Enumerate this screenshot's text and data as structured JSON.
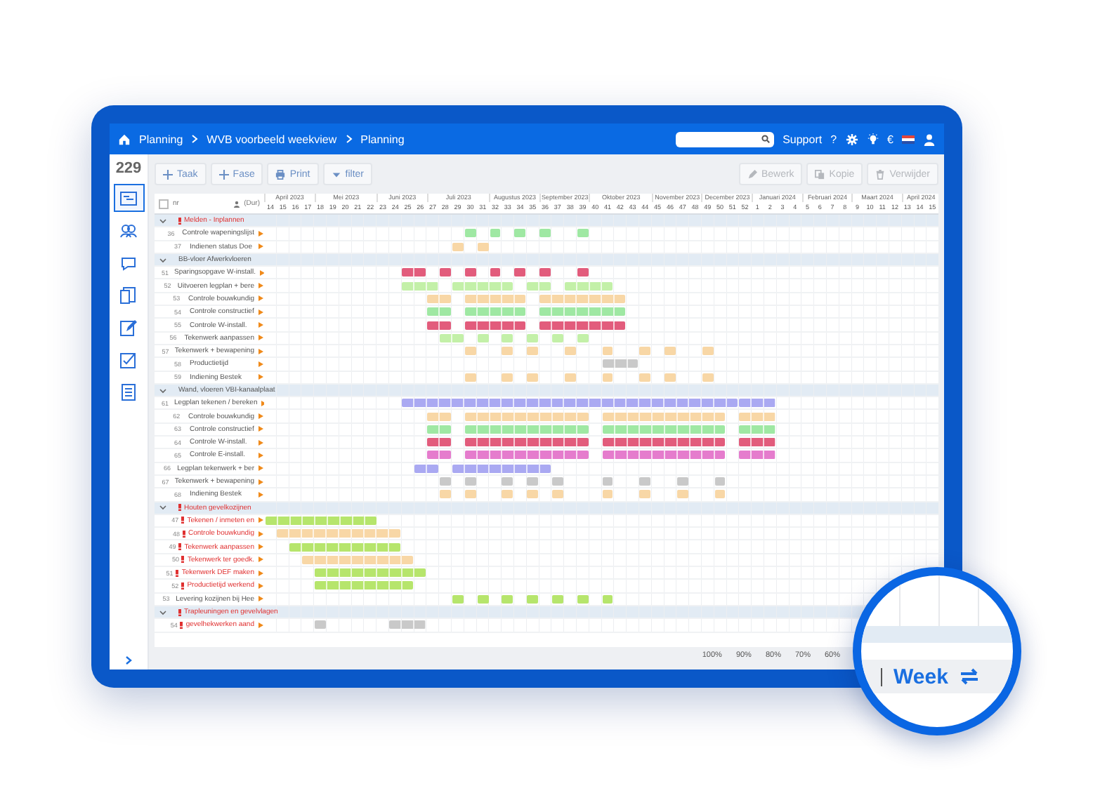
{
  "nav": {
    "breadcrumb": [
      "Planning",
      "WVB voorbeeld weekview",
      "Planning"
    ],
    "support": "Support",
    "help": "?",
    "currency": "€"
  },
  "sidebar": {
    "count": "229",
    "items": [
      {
        "selected": true
      },
      {
        "selected": false
      },
      {
        "selected": false
      },
      {
        "selected": false
      },
      {
        "selected": false
      },
      {
        "selected": false
      },
      {
        "selected": false
      }
    ]
  },
  "toolbar": {
    "left": [
      {
        "label": "Taak",
        "kind": "add",
        "disabled": false
      },
      {
        "label": "Fase",
        "kind": "add",
        "disabled": false
      },
      {
        "label": "Print",
        "kind": "print",
        "disabled": false
      },
      {
        "label": "filter",
        "kind": "filter",
        "disabled": false
      }
    ],
    "right": [
      {
        "label": "Bewerk",
        "kind": "edit",
        "disabled": true
      },
      {
        "label": "Kopie",
        "kind": "copy",
        "disabled": true
      },
      {
        "label": "Verwijder",
        "kind": "delete",
        "disabled": true
      }
    ]
  },
  "gantt": {
    "header": {
      "nr": "nr",
      "duration": "(Dur)",
      "checked": false
    },
    "months": [
      {
        "label": "April 2023",
        "weeks": [
          "14",
          "15",
          "16",
          "17"
        ]
      },
      {
        "label": "Mei 2023",
        "weeks": [
          "18",
          "19",
          "20",
          "21",
          "22"
        ]
      },
      {
        "label": "Juni 2023",
        "weeks": [
          "23",
          "24",
          "25",
          "26"
        ]
      },
      {
        "label": "Juli 2023",
        "weeks": [
          "27",
          "28",
          "29",
          "30",
          "31"
        ]
      },
      {
        "label": "Augustus 2023",
        "weeks": [
          "32",
          "33",
          "34",
          "35"
        ]
      },
      {
        "label": "September 2023",
        "weeks": [
          "36",
          "37",
          "38",
          "39"
        ]
      },
      {
        "label": "Oktober 2023",
        "weeks": [
          "40",
          "41",
          "42",
          "43",
          "44"
        ]
      },
      {
        "label": "November 2023",
        "weeks": [
          "45",
          "46",
          "47",
          "48"
        ]
      },
      {
        "label": "December 2023",
        "weeks": [
          "49",
          "50",
          "51",
          "52"
        ]
      },
      {
        "label": "Januari 2024",
        "weeks": [
          "1",
          "2",
          "3",
          "4"
        ]
      },
      {
        "label": "Februari 2024",
        "weeks": [
          "5",
          "6",
          "7",
          "8"
        ]
      },
      {
        "label": "Maart 2024",
        "weeks": [
          "9",
          "10",
          "11",
          "12"
        ]
      },
      {
        "label": "April 2024",
        "weeks": [
          "13",
          "14",
          "15"
        ]
      }
    ],
    "rows": [
      {
        "kind": "group",
        "name": "Melden - Inplannen",
        "alert": true,
        "expanded": true
      },
      {
        "kind": "task",
        "nr": "36",
        "name": "Controle wapeningslijst",
        "alert": false,
        "color": "#9fe8a3"
      },
      {
        "kind": "task",
        "nr": "37",
        "name": "Indienen status Doe",
        "alert": false,
        "color": "#f8d7a6"
      },
      {
        "kind": "group",
        "name": "BB-vloer Afwerkvloeren",
        "alert": false,
        "expanded": true
      },
      {
        "kind": "task",
        "nr": "51",
        "name": "Sparingsopgave W-install.",
        "alert": false,
        "color": "#e25c7c"
      },
      {
        "kind": "task",
        "nr": "52",
        "name": "Uitvoeren legplan + bere",
        "alert": false,
        "color": "#c3f0a8"
      },
      {
        "kind": "task",
        "nr": "53",
        "name": "Controle bouwkundig",
        "alert": false,
        "color": "#f8d7a6"
      },
      {
        "kind": "task",
        "nr": "54",
        "name": "Controle constructief",
        "alert": false,
        "color": "#9fe8a3"
      },
      {
        "kind": "task",
        "nr": "55",
        "name": "Controle W-install.",
        "alert": false,
        "color": "#e25c7c"
      },
      {
        "kind": "task",
        "nr": "56",
        "name": "Tekenwerk aanpassen",
        "alert": false,
        "color": "#c3f0a8"
      },
      {
        "kind": "task",
        "nr": "57",
        "name": "Tekenwerk + bewapening",
        "alert": false,
        "color": "#f8d7a6"
      },
      {
        "kind": "task",
        "nr": "58",
        "name": "Productietijd",
        "alert": false,
        "color": "#c9c9c9"
      },
      {
        "kind": "task",
        "nr": "59",
        "name": "Indiening Bestek",
        "alert": false,
        "color": "#f8d7a6"
      },
      {
        "kind": "group",
        "name": "Wand, vloeren VBI-kanaalplaat",
        "alert": false,
        "expanded": true
      },
      {
        "kind": "task",
        "nr": "61",
        "name": "Legplan tekenen / bereken",
        "alert": false,
        "color": "#aaa9f2"
      },
      {
        "kind": "task",
        "nr": "62",
        "name": "Controle bouwkundig",
        "alert": false,
        "color": "#f8d7a6"
      },
      {
        "kind": "task",
        "nr": "63",
        "name": "Controle constructief",
        "alert": false,
        "color": "#9fe8a3"
      },
      {
        "kind": "task",
        "nr": "64",
        "name": "Controle W-install.",
        "alert": false,
        "color": "#e25c7c"
      },
      {
        "kind": "task",
        "nr": "65",
        "name": "Controle E-install.",
        "alert": false,
        "color": "#e57ccd"
      },
      {
        "kind": "task",
        "nr": "66",
        "name": "Legplan tekenwerk + ber",
        "alert": false,
        "color": "#aaa9f2"
      },
      {
        "kind": "task",
        "nr": "67",
        "name": "Tekenwerk + bewapening",
        "alert": false,
        "color": "#c9c9c9"
      },
      {
        "kind": "task",
        "nr": "68",
        "name": "Indiening Bestek",
        "alert": false,
        "color": "#f8d7a6"
      },
      {
        "kind": "group",
        "name": "Houten gevelkozijnen",
        "alert": true,
        "expanded": true
      },
      {
        "kind": "task",
        "nr": "47",
        "name": "Tekenen / inmeten en",
        "alert": true,
        "color": "#b6e56c"
      },
      {
        "kind": "task",
        "nr": "48",
        "name": "Controle bouwkundig",
        "alert": true,
        "color": "#f8d7a6"
      },
      {
        "kind": "task",
        "nr": "49",
        "name": "Tekenwerk aanpassen",
        "alert": true,
        "color": "#b6e56c"
      },
      {
        "kind": "task",
        "nr": "50",
        "name": "Tekenwerk ter goedk.",
        "alert": true,
        "color": "#f8d7a6"
      },
      {
        "kind": "task",
        "nr": "51",
        "name": "Tekenwerk DEF maken",
        "alert": true,
        "color": "#b6e56c"
      },
      {
        "kind": "task",
        "nr": "52",
        "name": "Productietijd werkend",
        "alert": true,
        "color": "#b6e56c"
      },
      {
        "kind": "task",
        "nr": "53",
        "name": "Levering kozijnen bij Hee",
        "alert": false,
        "color": "#b6e56c"
      },
      {
        "kind": "group",
        "name": "Trapleuningen en gevelvlagen",
        "alert": true,
        "expanded": true
      },
      {
        "kind": "task",
        "nr": "54",
        "name": "gevelhekwerken aand",
        "alert": true,
        "color": "#c9c9c9"
      }
    ]
  },
  "footer": {
    "zoom": [
      "100%",
      "90%",
      "80%",
      "70%",
      "60%"
    ]
  },
  "view": {
    "label": "Week"
  }
}
